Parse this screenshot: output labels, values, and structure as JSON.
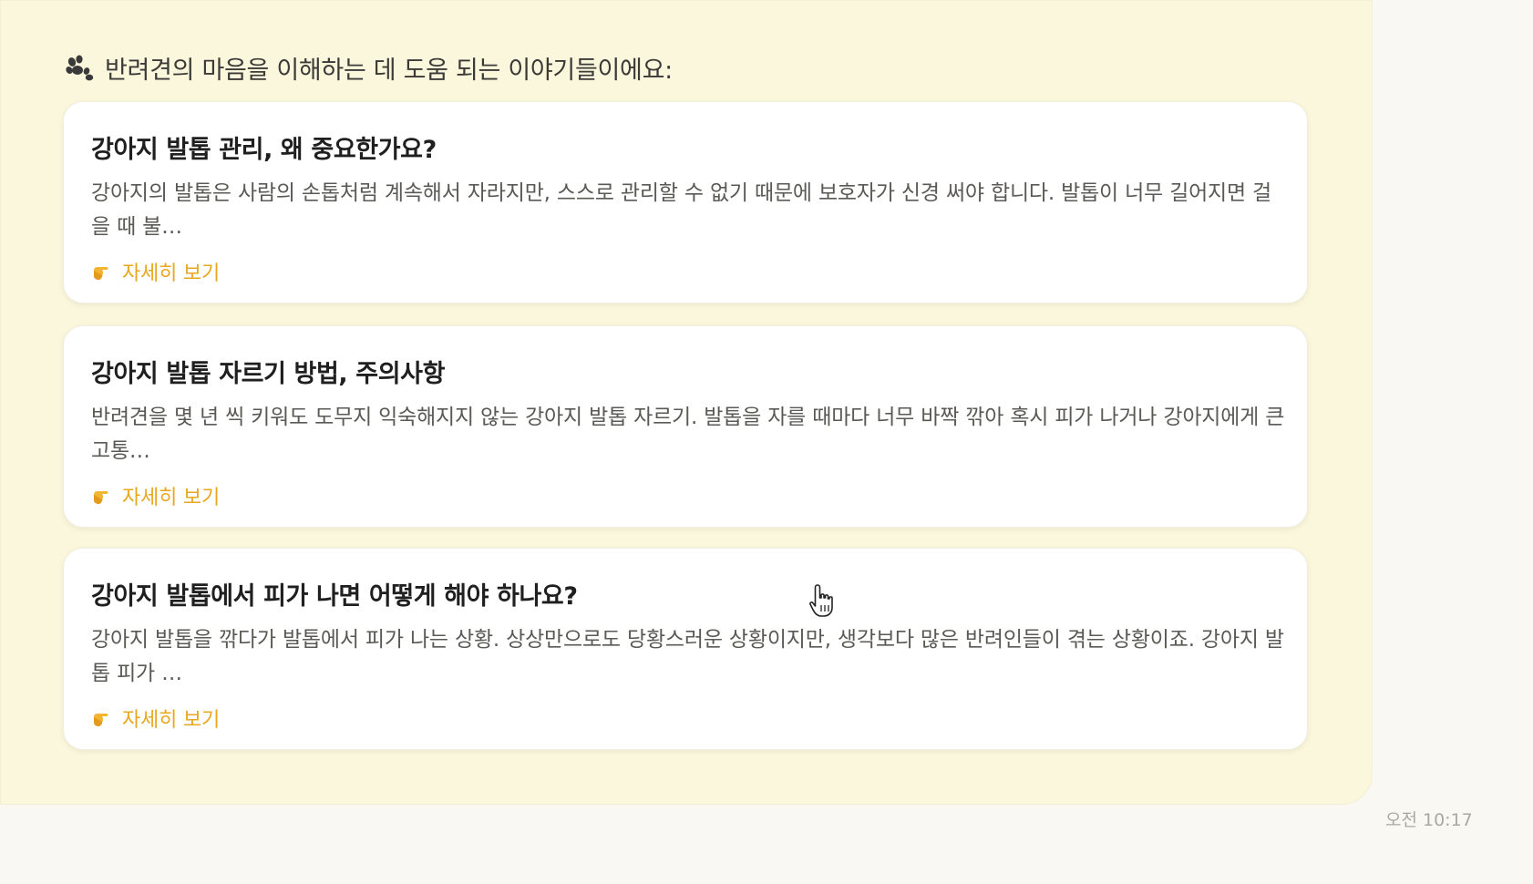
{
  "message": {
    "heading_icon": "paw-icon",
    "heading": "반려견의 마음을 이해하는 데 도움 되는 이야기들이에요:",
    "timestamp": "오전 10:17"
  },
  "articles": [
    {
      "title": "강아지 발톱 관리, 왜 중요한가요?",
      "excerpt": "강아지의 발톱은 사람의 손톱처럼 계속해서 자라지만, 스스로 관리할 수 없기 때문에 보호자가 신경 써야 합니다. 발톱이 너무 길어지면 걸을 때 불…",
      "link_label": "자세히 보기",
      "link_icon": "pointing-hand-icon"
    },
    {
      "title": "강아지 발톱 자르기 방법, 주의사항",
      "excerpt": "반려견을 몇 년 씩 키워도 도무지 익숙해지지 않는 강아지 발톱 자르기. 발톱을 자를 때마다 너무 바짝 깎아 혹시 피가 나거나 강아지에게 큰 고통…",
      "link_label": "자세히 보기",
      "link_icon": "pointing-hand-icon"
    },
    {
      "title": "강아지 발톱에서 피가 나면 어떻게 해야 하나요?",
      "excerpt": "강아지 발톱을 깎다가 발톱에서 피가 나는 상황. 상상만으로도 당황스러운 상황이지만, 생각보다 많은 반려인들이 겪는 상황이죠. 강아지 발톱 피가 …",
      "link_label": "자세히 보기",
      "link_icon": "pointing-hand-icon"
    }
  ],
  "colors": {
    "bubble_bg": "#faf7dd",
    "link": "#e8a71f",
    "card_bg": "#ffffff"
  }
}
